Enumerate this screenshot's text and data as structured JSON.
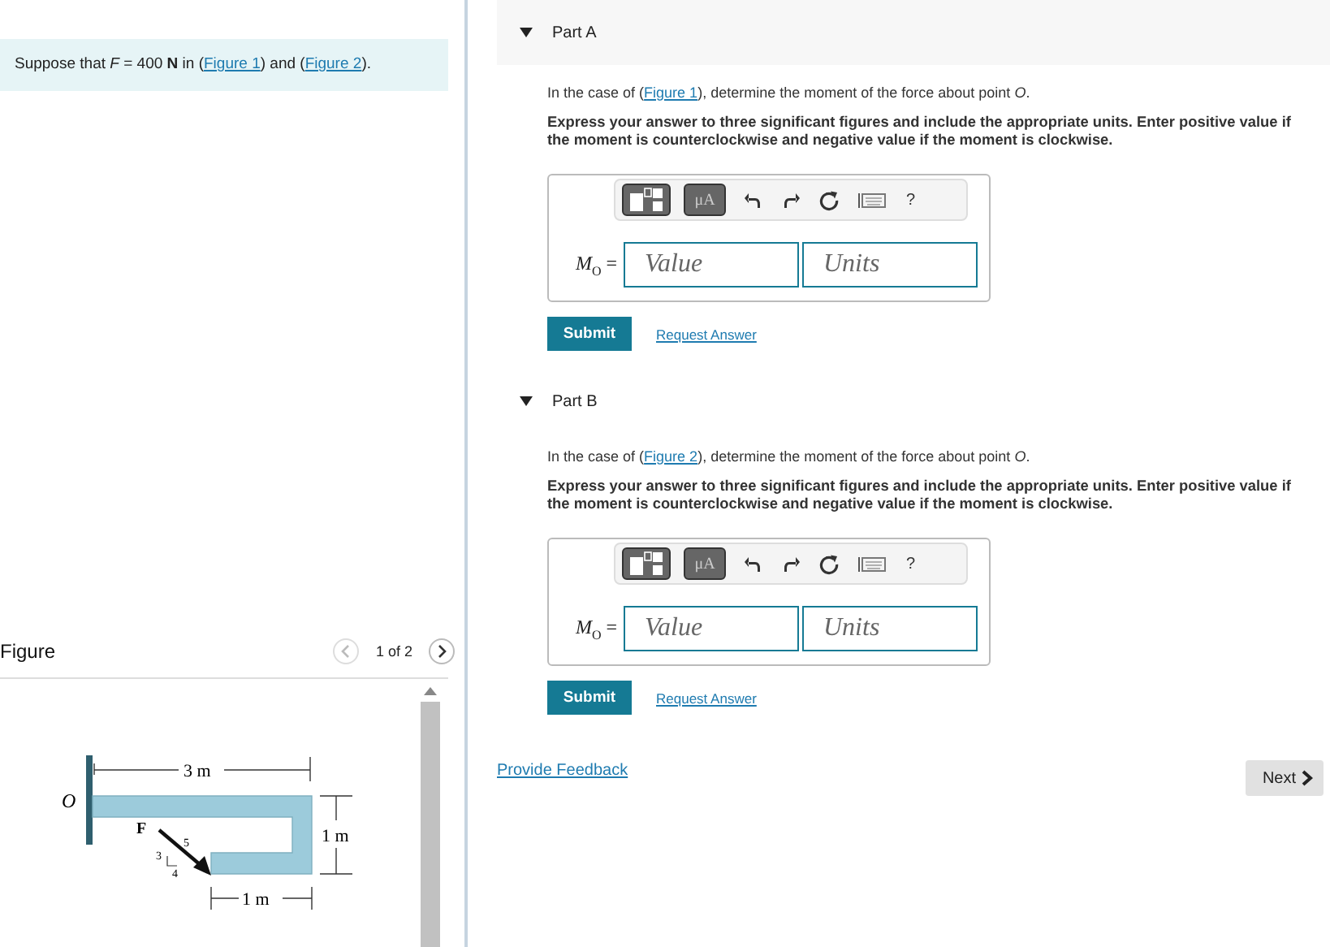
{
  "intro": [
    {
      "kind": "text",
      "text": "Suppose that *F* = 400 **N** in ("
    },
    {
      "kind": "link",
      "text": "Figure 1"
    },
    {
      "kind": "text",
      "text": ") and ("
    },
    {
      "kind": "link",
      "text": "Figure 2"
    },
    {
      "kind": "text",
      "text": ")."
    }
  ],
  "figure": {
    "title": "Figure",
    "pager": "1 of 2",
    "labels": {
      "o": "O",
      "span": "3 m",
      "height": "1 m",
      "arm": "1 m",
      "force": "F",
      "rise": "3",
      "run": "4",
      "hyp": "5"
    }
  },
  "parts": [
    {
      "title": "Part A",
      "expanded": true,
      "question": [
        {
          "kind": "text",
          "text": "In the case of ("
        },
        {
          "kind": "link",
          "text": "Figure 1"
        },
        {
          "kind": "text",
          "text": "), determine the moment of the force about point *O*."
        }
      ],
      "instructions": "Express your answer to three significant figures and include the appropriate units. Enter positive value if the moment is counterclockwise and negative value if the moment is clockwise.",
      "unit_button": "μA",
      "help": "?",
      "variable": "*M*$_{O}$ =",
      "value_placeholder": "Value",
      "units_placeholder": "Units",
      "submit": "Submit",
      "request": "Request Answer"
    },
    {
      "title": "Part B",
      "expanded": true,
      "question": [
        {
          "kind": "text",
          "text": "In the case of ("
        },
        {
          "kind": "link",
          "text": "Figure 2"
        },
        {
          "kind": "text",
          "text": "), determine the moment of the force about point *O*."
        }
      ],
      "instructions": "Express your answer to three significant figures and include the appropriate units. Enter positive value if the moment is counterclockwise and negative value if the moment is clockwise.",
      "unit_button": "μA",
      "help": "?",
      "variable": "*M*$_{O}$ =",
      "value_placeholder": "Value",
      "units_placeholder": "Units",
      "submit": "Submit",
      "request": "Request Answer"
    }
  ],
  "feedback": "Provide Feedback",
  "next": "Next"
}
